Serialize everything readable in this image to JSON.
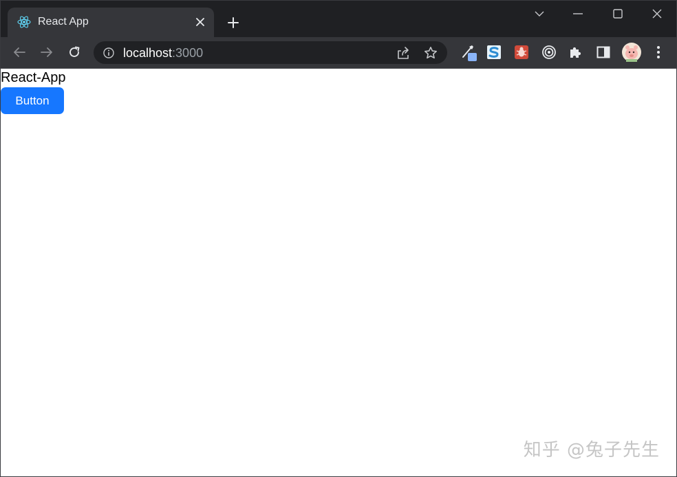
{
  "tab": {
    "title": "React App",
    "favicon": "react-logo-icon"
  },
  "address_bar": {
    "host": "localhost",
    "port": ":3000"
  },
  "page": {
    "title": "React-App",
    "button_label": "Button"
  },
  "watermark": "知乎 @兔子先生",
  "colors": {
    "tabstrip_bg": "#1f2023",
    "toolbar_bg": "#35363a",
    "omnibox_bg": "#202124",
    "primary_button": "#1677ff",
    "react_blue": "#61dafb"
  },
  "icons": {
    "tab_close": "close-icon",
    "new_tab": "plus-icon",
    "tab_search": "chevron-down-icon",
    "minimize": "minimize-icon",
    "maximize": "maximize-icon",
    "close_window": "close-window-icon",
    "back": "back-arrow-icon",
    "forward": "forward-arrow-icon",
    "reload": "reload-icon",
    "site_info": "info-icon",
    "share": "share-icon",
    "bookmark": "star-icon",
    "extensions": [
      "eyedropper-extension-icon",
      "s-extension-icon",
      "bug-extension-icon",
      "target-extension-icon",
      "puzzle-icon",
      "side-panel-icon",
      "profile-avatar",
      "kebab-menu-icon"
    ]
  }
}
